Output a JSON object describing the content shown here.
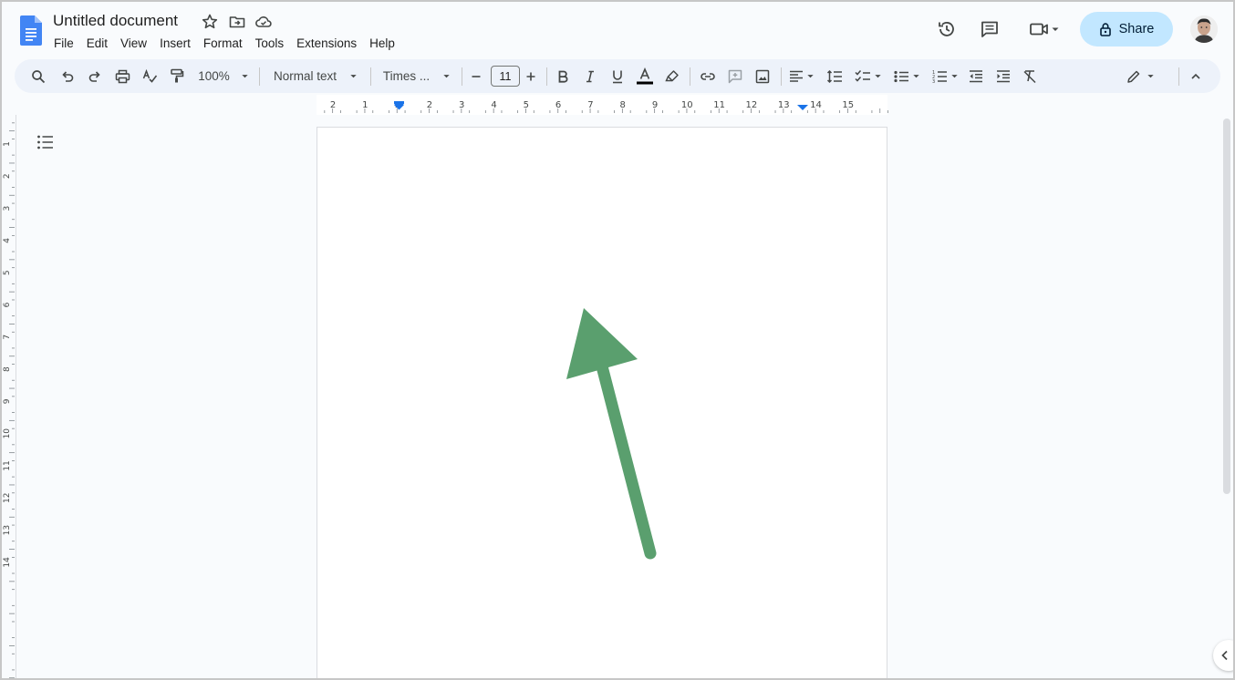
{
  "app": {
    "title": "Untitled document",
    "menu": [
      "File",
      "Edit",
      "View",
      "Insert",
      "Format",
      "Tools",
      "Extensions",
      "Help"
    ],
    "share_label": "Share"
  },
  "toolbar": {
    "zoom": "100%",
    "style": "Normal text",
    "font": "Times ...",
    "font_size": "11"
  },
  "ruler": {
    "top_labels": [
      "2",
      "1",
      "1",
      "2",
      "3",
      "4",
      "5",
      "6",
      "7",
      "8",
      "9",
      "10",
      "11",
      "12",
      "13",
      "14",
      "15"
    ],
    "side_labels": [
      "1",
      "2",
      "3",
      "4",
      "5",
      "6",
      "7",
      "8",
      "9",
      "10",
      "11",
      "12",
      "13",
      "14"
    ]
  },
  "colors": {
    "accent": "#1a73e8",
    "share_bg": "#c2e7ff",
    "toolbar_bg": "#edf2fa",
    "arrow": "#5a9f6e"
  },
  "icons": {
    "logo": "google-docs-logo",
    "star": "star-icon",
    "move": "move-to-folder-icon",
    "cloud": "cloud-saved-icon",
    "history": "history-icon",
    "comments": "comment-icon",
    "meet": "video-camera-icon",
    "lock": "lock-icon"
  }
}
